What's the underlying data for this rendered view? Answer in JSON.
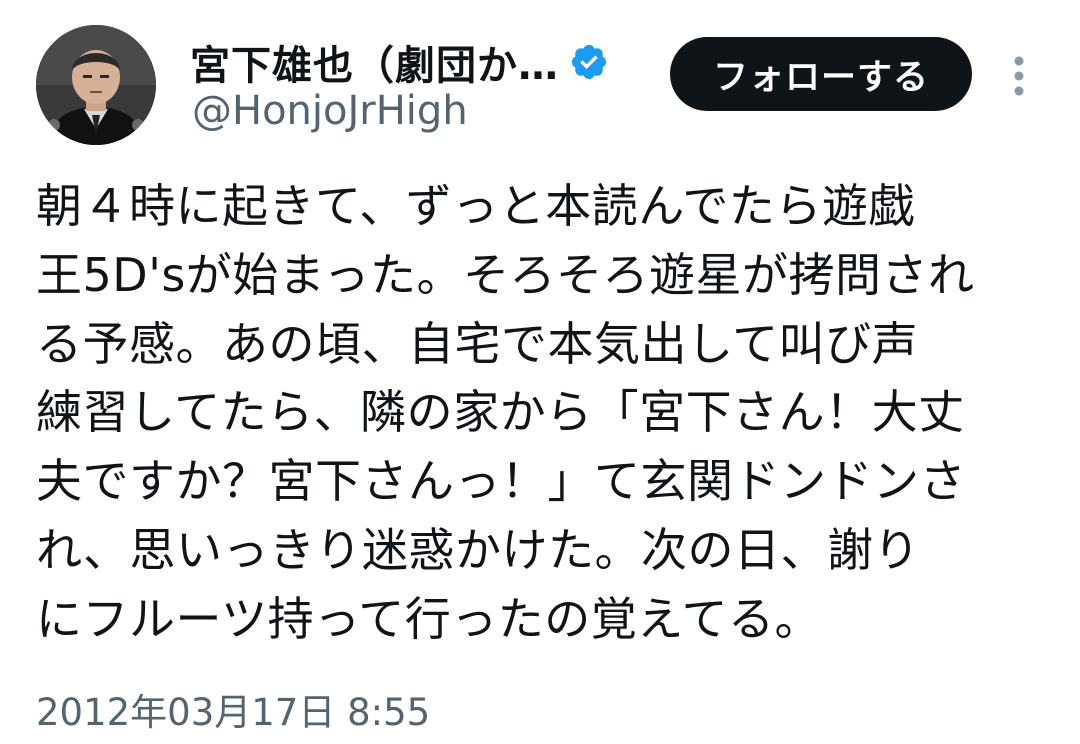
{
  "author": {
    "display_name": "宮下雄也（劇団か…",
    "handle": "@HonjoJrHigh",
    "verified": true
  },
  "follow_button": {
    "label": "フォローする"
  },
  "more_button": {
    "icon": "more-vertical-icon"
  },
  "tweet": {
    "text": "朝４時に起きて、ずっと本読んでたら遊戯\n王5D'sが始まった。そろそろ遊星が拷問され\nる予感。あの頃、自宅で本気出して叫び声\n練習してたら、隣の家から「宮下さん！大丈\n夫ですか？宮下さんっ！」て玄関ドンドンさ\nれ、思いっきり迷惑かけた。次の日、謝り\nにフルーツ持って行ったの覚えてる。",
    "timestamp": "2012年03月17日 8:55"
  },
  "colors": {
    "text_primary": "#0f1419",
    "text_secondary": "#536471",
    "verified_blue": "#1d9bf0",
    "button_bg": "#0f1419"
  }
}
